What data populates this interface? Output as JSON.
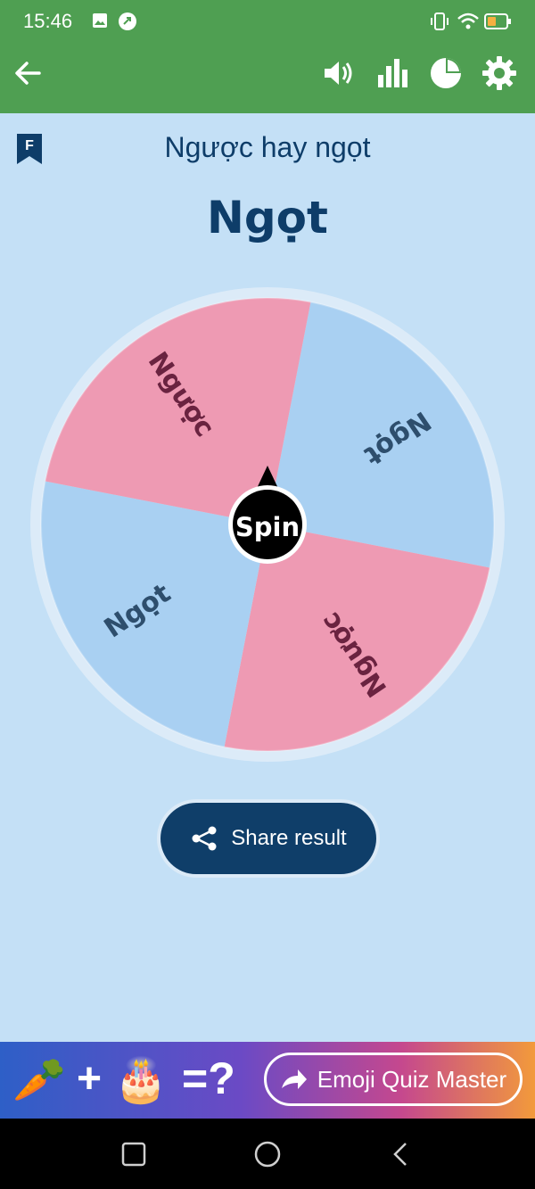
{
  "status_bar": {
    "time": "15:46"
  },
  "toolbar": {
    "back_icon": "arrow-left-icon",
    "icons": [
      "volume-icon",
      "bar-chart-icon",
      "pie-chart-icon",
      "gear-icon"
    ]
  },
  "page": {
    "title": "Ngược hay ngọt",
    "result": "Ngọt",
    "bookmark_letter": "F"
  },
  "wheel": {
    "segments": [
      {
        "label": "Ngọt",
        "color": "#a9d0f2",
        "text_color": "#2e4e6d"
      },
      {
        "label": "Ngược",
        "color": "#ee9ab3",
        "text_color": "#6a2340"
      },
      {
        "label": "Ngọt",
        "color": "#a9d0f2",
        "text_color": "#2e4e6d"
      },
      {
        "label": "Ngược",
        "color": "#ee9ab3",
        "text_color": "#6a2340"
      }
    ],
    "center_label": "Spin"
  },
  "share": {
    "label": "Share result"
  },
  "ad": {
    "emoji_left": "🥕",
    "plus": "+",
    "emoji_right": "🎂",
    "equals": "=?",
    "button_label": "Emoji Quiz Master"
  },
  "colors": {
    "toolbar": "#4f9f52",
    "background": "#c4e0f6",
    "accent": "#0f3e69"
  }
}
